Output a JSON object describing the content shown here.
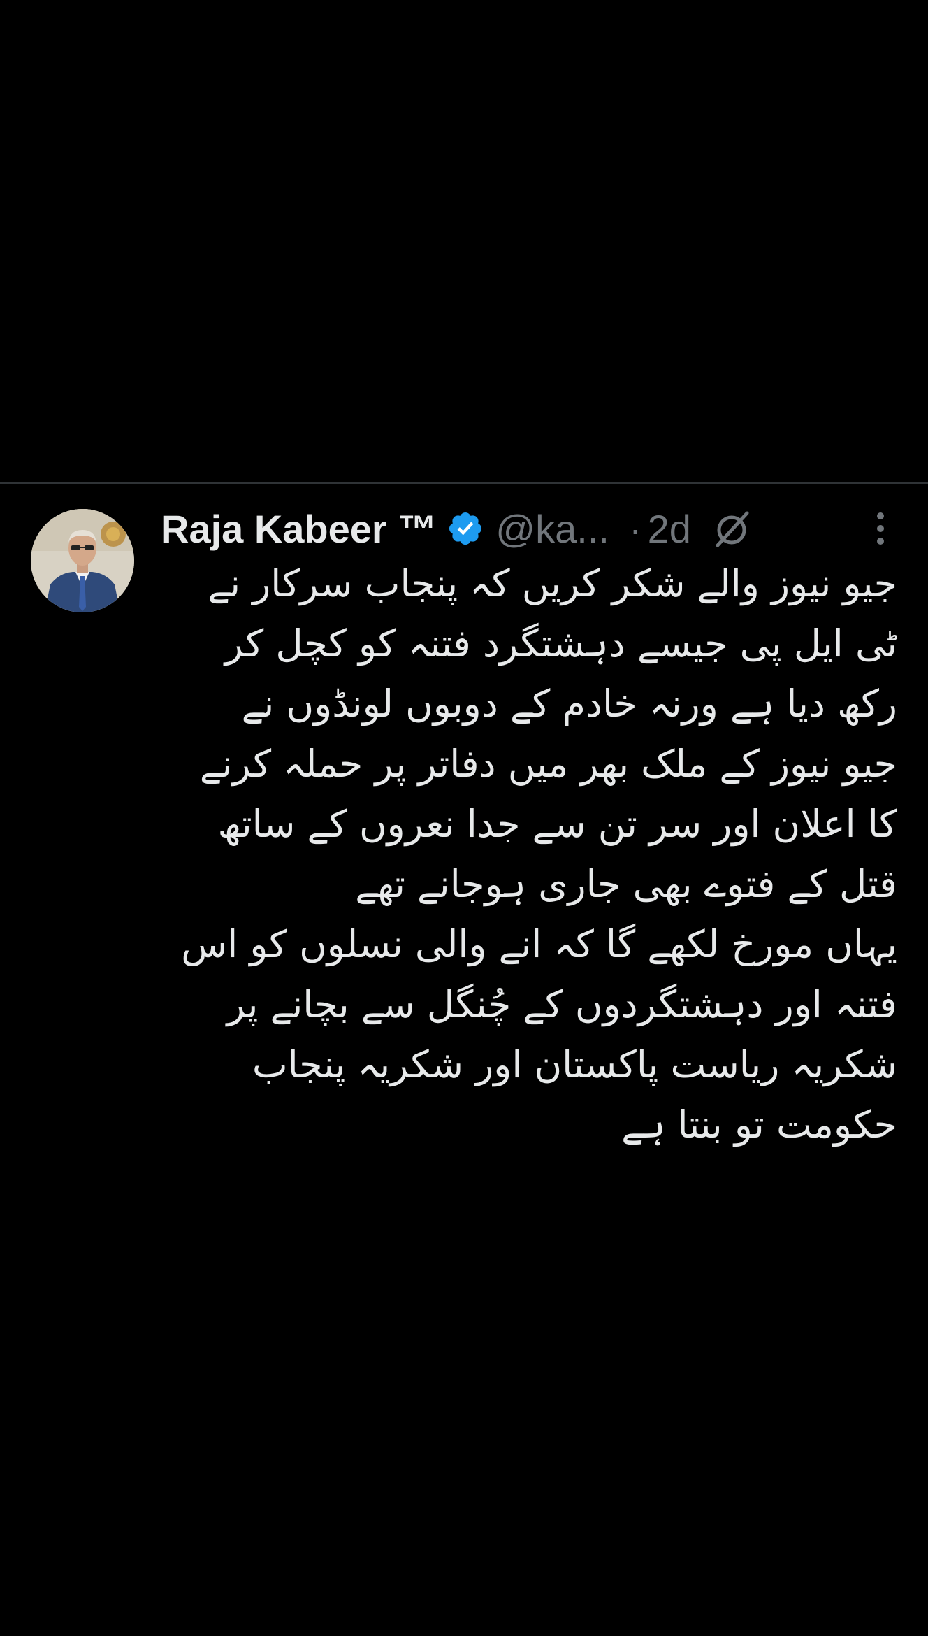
{
  "tweet": {
    "author_name": "Raja Kabeer ™",
    "handle": "@ka...",
    "separator": "·",
    "time": "2d",
    "lines": [
      "جیو نیوز والے شکر کریں کہ پنجاب سرکار نے",
      "ٹی ایل پی جیسے دہشتگرد فتنہ کو کچل کر",
      "رکھ دیا ہے ورنہ خادم کے دوبوں لونڈوں نے",
      "جیو نیوز کے ملک بھر میں دفاتر پر حملہ کرنے",
      "کا اعلان اور سر تن سے جدا نعروں کے ساتھ",
      "قتل کے فتوے بھی جاری ہوجانے تھے",
      "یہاں مورخ لکھے گا کہ انے والی نسلوں کو اس",
      "فتنہ اور دہشتگردوں کے چُنگل سے بچانے پر",
      "شکریہ ریاست پاکستان اور شکریہ پنجاب",
      "حکومت تو بنتا ہے"
    ]
  },
  "icons": {
    "verified": "verified-badge-icon",
    "grok": "grok-icon",
    "more": "more-options-icon"
  },
  "colors": {
    "background": "#000000",
    "text_primary": "#e7e9ea",
    "text_secondary": "#71767b",
    "verified_blue": "#1d9bf0",
    "divider": "#2f3336"
  }
}
